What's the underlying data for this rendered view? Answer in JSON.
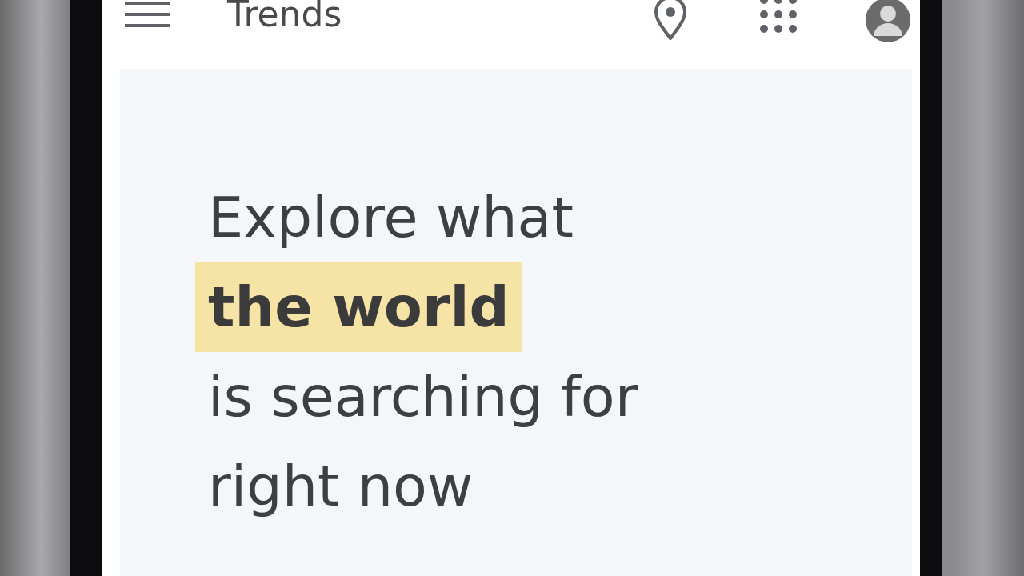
{
  "app_bar": {
    "title": "Trends"
  },
  "headline": {
    "parts": [
      {
        "text": "Explore what",
        "highlighted": false
      },
      {
        "text": "the world",
        "highlighted": true
      },
      {
        "text": "is searching for",
        "highlighted": false
      },
      {
        "text": "right now",
        "highlighted": false
      }
    ]
  }
}
